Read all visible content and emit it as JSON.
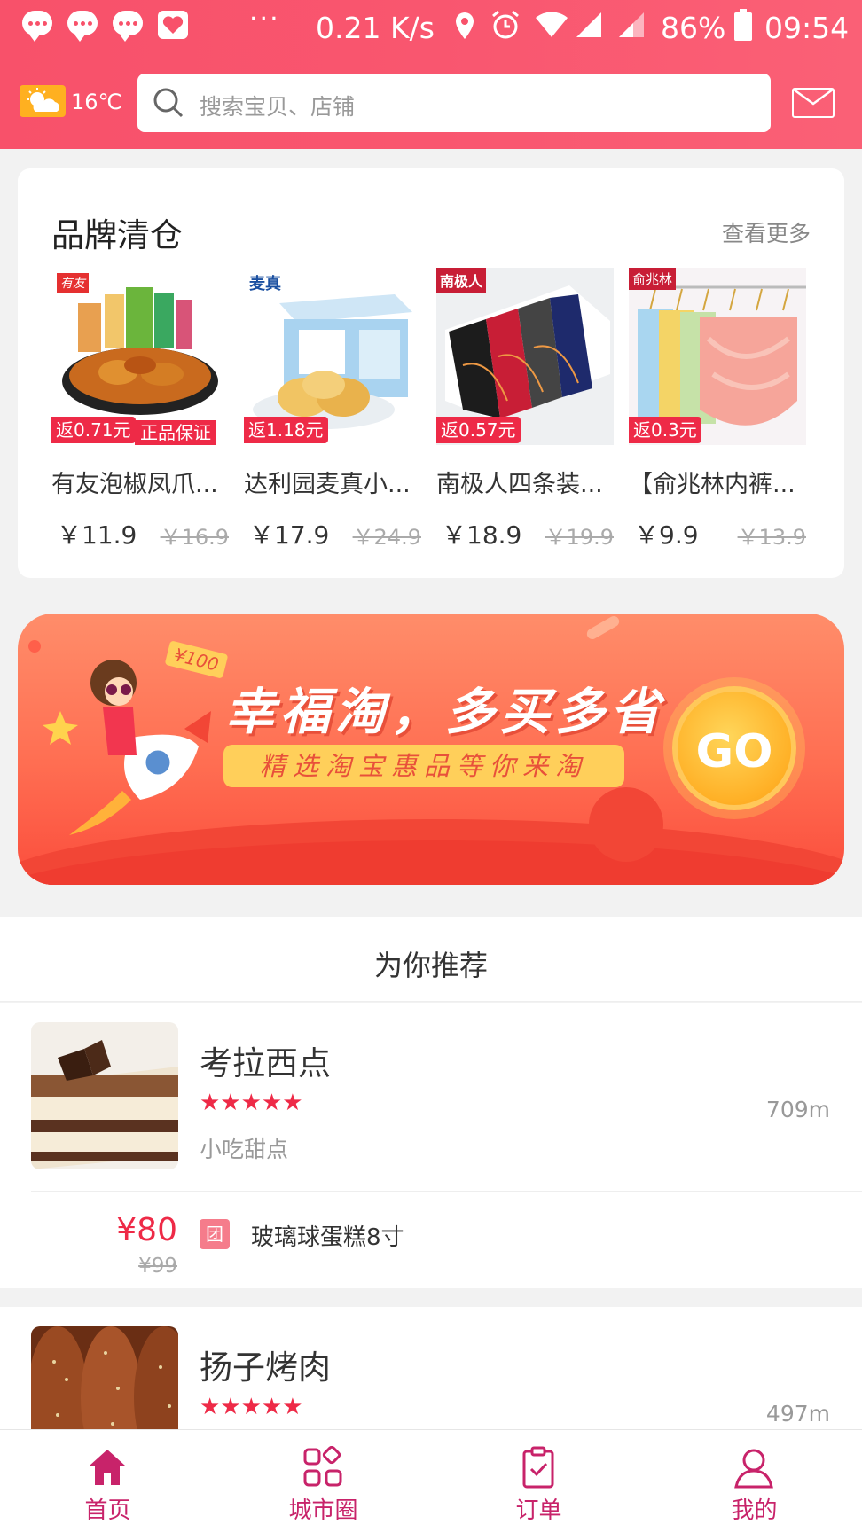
{
  "status_bar": {
    "speed": "0.21 K/s",
    "battery": "86%",
    "time": "09:54",
    "icons": [
      "message-icon",
      "message-icon",
      "message-icon",
      "heart-app-icon",
      "location-icon",
      "alarm-icon",
      "wifi-icon",
      "signal-icon",
      "battery-icon"
    ]
  },
  "header": {
    "temperature": "16℃",
    "weather_icon": "partly-sunny-icon",
    "search_placeholder": "搜索宝贝、店铺",
    "mail_icon": "mail-icon"
  },
  "brand_clearance": {
    "title": "品牌清仓",
    "more": "查看更多",
    "products": [
      {
        "name": "有友泡椒凤爪...",
        "rebate": "返0.71元",
        "badge": "正品保证",
        "price": "￥11.9",
        "old_price": "￥16.9",
        "logo": "有友"
      },
      {
        "name": "达利园麦真小...",
        "rebate": "返1.18元",
        "badge": "",
        "price": "￥17.9",
        "old_price": "￥24.9",
        "logo": "麦真"
      },
      {
        "name": "南极人四条装...",
        "rebate": "返0.57元",
        "badge": "",
        "price": "￥18.9",
        "old_price": "￥19.9",
        "logo": "南极人"
      },
      {
        "name": "【俞兆林内裤...",
        "rebate": "返0.3元",
        "badge": "",
        "price": "￥9.9",
        "old_price": "￥13.9",
        "logo": "俞兆林"
      }
    ]
  },
  "banner": {
    "title": "幸福淘，多买多省",
    "subtitle": "精选淘宝惠品等你来淘",
    "tag": "¥100",
    "go": "GO"
  },
  "recommend": {
    "title": "为你推荐",
    "shops": [
      {
        "name": "考拉西点",
        "stars": "★★★★★",
        "category": "小吃甜点",
        "distance": "709m",
        "deal": {
          "price": "¥80",
          "old_price": "¥99",
          "tag": "团",
          "name": "玻璃球蛋糕8寸"
        }
      },
      {
        "name": "扬子烤肉",
        "stars": "★★★★★",
        "category": "",
        "distance": "497m"
      }
    ]
  },
  "tabbar": {
    "tabs": [
      {
        "label": "首页",
        "icon": "home-icon",
        "active": true
      },
      {
        "label": "城市圈",
        "icon": "grid-icon",
        "active": false
      },
      {
        "label": "订单",
        "icon": "clipboard-icon",
        "active": false
      },
      {
        "label": "我的",
        "icon": "user-icon",
        "active": false
      }
    ]
  },
  "colors": {
    "primary": "#f8516a",
    "accent_red": "#ee2a47",
    "tab_active": "#c8236a"
  }
}
